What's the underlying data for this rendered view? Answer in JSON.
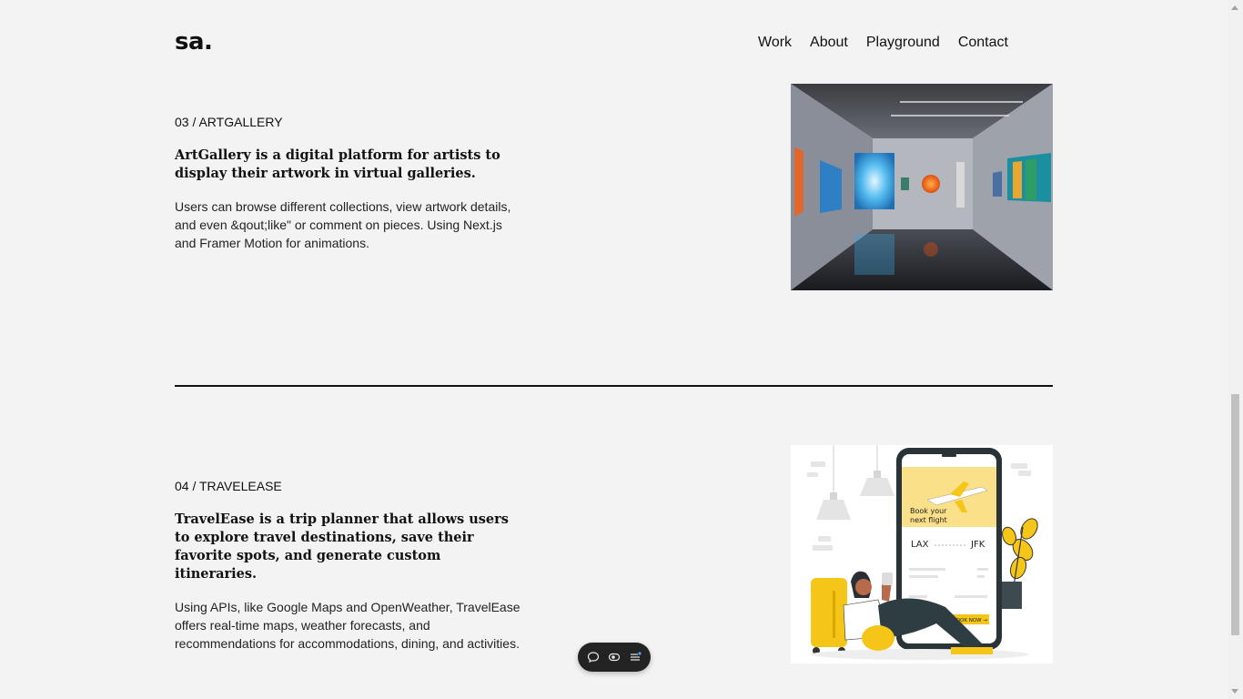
{
  "header": {
    "logo": "sa.",
    "nav": [
      "Work",
      "About",
      "Playground",
      "Contact"
    ]
  },
  "projects": [
    {
      "number": "03 / ARTGALLERY",
      "title": "ArtGallery is a digital platform for artists to display their artwork in virtual galleries.",
      "description": "Users can browse different collections, view artwork details, and even &qout;like\" or comment on pieces. Using Next.js and Framer Motion for animations.",
      "image": "gallery-photo"
    },
    {
      "number": "04 / TRAVELEASE",
      "title": "TravelEase is a trip planner that allows users to explore travel destinations, save their favorite spots, and generate custom itineraries.",
      "description": "Using APIs, like Google Maps and OpenWeather, TravelEase offers real-time maps, weather forecasts, and recommendations for accommodations, dining, and activities.",
      "image": "travel-illustration",
      "illustration": {
        "heading_line1": "Book your",
        "heading_line2": "next flight",
        "from": "LAX",
        "to": "JFK",
        "cta": "BOOK NOW →"
      }
    }
  ],
  "toolbar": {
    "icons": [
      "comment-icon",
      "eye-icon",
      "menu-icon"
    ]
  },
  "colors": {
    "background": "#f3f3f3",
    "text": "#111111",
    "accent_yellow": "#f5c518",
    "toolbar": "#232323"
  }
}
